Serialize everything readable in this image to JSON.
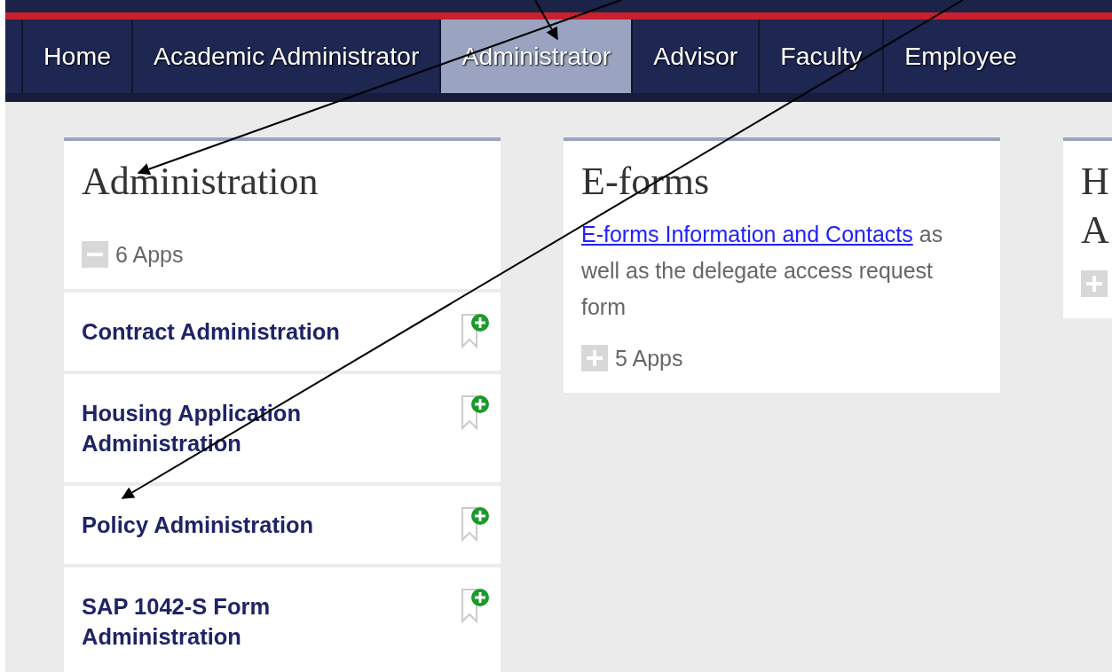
{
  "nav": {
    "tabs": [
      {
        "label": "Home",
        "selected": false
      },
      {
        "label": "Academic Administrator",
        "selected": false
      },
      {
        "label": "Administrator",
        "selected": true
      },
      {
        "label": "Advisor",
        "selected": false
      },
      {
        "label": "Faculty",
        "selected": false
      },
      {
        "label": "Employee",
        "selected": false
      }
    ]
  },
  "cards": [
    {
      "title_lines": [
        "Administration"
      ],
      "apps": {
        "count": "6 Apps",
        "expanded": true
      },
      "items": [
        {
          "label": "Contract Administration"
        },
        {
          "label": "Housing Application Administration"
        },
        {
          "label": "Policy Administration"
        },
        {
          "label": "SAP 1042-S Form Administration"
        }
      ]
    },
    {
      "title_lines": [
        "E-forms"
      ],
      "link": "E-forms Information and Contacts",
      "description": " as well as the delegate access request form",
      "apps": {
        "count": "5 Apps",
        "expanded": false
      }
    },
    {
      "title_lines": [
        "H",
        "A"
      ],
      "apps": {
        "expanded": false
      }
    }
  ]
}
